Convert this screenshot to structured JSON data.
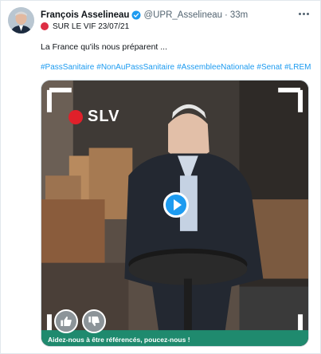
{
  "tweet": {
    "author_name": "François Asselineau",
    "handle": "@UPR_Asselineau",
    "separator": "·",
    "time": "33m",
    "subline": "SUR LE VIF 23/07/21",
    "text": "La France qu'ils nous préparent ...",
    "hashtags": [
      "#PassSanitaire",
      "#NonAuPassSanitaire",
      "#AssembleeNationale",
      "#Senat",
      "#LREM"
    ],
    "icons": {
      "verified": "verified-badge-icon",
      "more": "more-options-icon",
      "subline_dot": "red-circle-icon"
    }
  },
  "video": {
    "logo_text": "SLV",
    "bottom_caption": "Aidez-nous à être référencés, poucez-nous !",
    "icons": {
      "play": "play-icon",
      "thumb_up": "thumbs-up-icon",
      "thumb_down": "thumbs-down-icon"
    }
  },
  "colors": {
    "link": "#1d9bf0",
    "verified": "#1d9bf0",
    "red_dot": "#dd2e44",
    "slv_red": "#e0202a",
    "caption_bar": "#1f8a6e"
  }
}
